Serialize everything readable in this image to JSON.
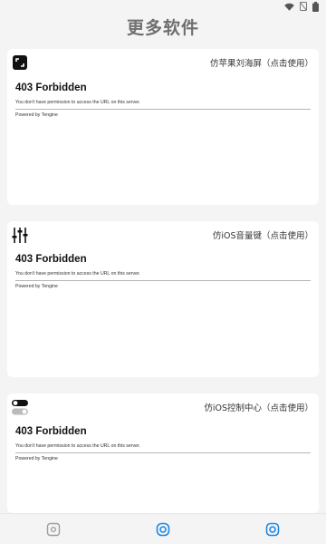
{
  "page_title": "更多软件",
  "status_bar": {
    "icons": [
      "wifi-icon",
      "no-sim-icon",
      "battery-icon"
    ]
  },
  "cards": [
    {
      "icon": "expand-corners-icon",
      "label": "仿苹果刘海屏（点击使用）",
      "error": {
        "title": "403 Forbidden",
        "message": "You don't have permission to access the URL on this server.",
        "powered": "Powered by Tengine"
      }
    },
    {
      "icon": "sliders-icon",
      "label": "仿iOS音量键（点击使用）",
      "error": {
        "title": "403 Forbidden",
        "message": "You don't have permission to access the URL on this server.",
        "powered": "Powered by Tengine"
      }
    },
    {
      "icon": "toggle-switches-icon",
      "label": "仿iOS控制中心（点击使用）",
      "error": {
        "title": "403 Forbidden",
        "message": "You don't have permission to access the URL on this server.",
        "powered": "Powered by Tengine"
      }
    }
  ],
  "bottom_nav": {
    "items": [
      {
        "icon": "tab-icon-home",
        "active": false
      },
      {
        "icon": "tab-icon-middle",
        "active": true
      },
      {
        "icon": "tab-icon-right",
        "active": true
      }
    ],
    "colors": {
      "active": "#1e88e5",
      "inactive": "#9e9e9e"
    }
  }
}
